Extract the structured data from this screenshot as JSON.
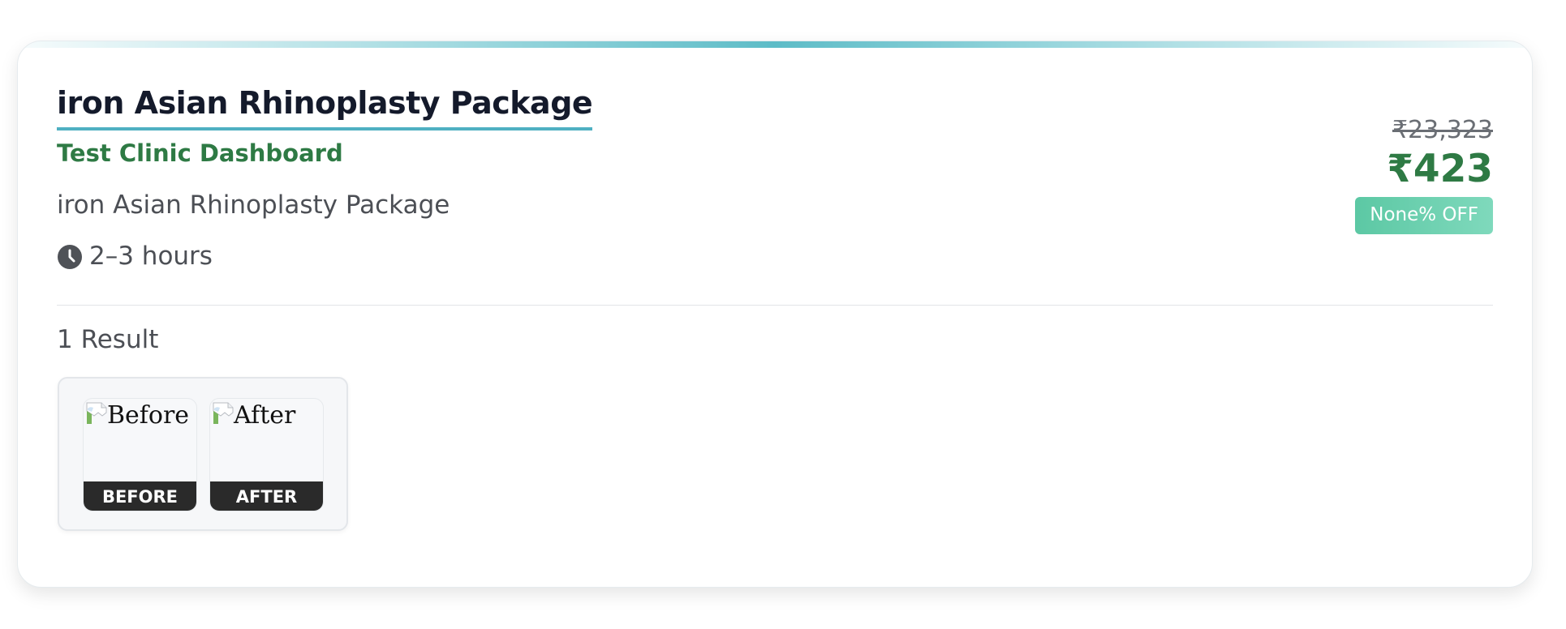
{
  "package": {
    "title": "iron Asian Rhinoplasty Package",
    "clinic": "Test Clinic Dashboard",
    "description": "iron Asian Rhinoplasty Package",
    "duration": "2–3 hours",
    "icons": {
      "duration": "clock-icon"
    }
  },
  "pricing": {
    "original_price": "₹23,323",
    "price": "₹423",
    "discount_badge": "None% OFF"
  },
  "results": {
    "count_label": "1 Result",
    "items": [
      {
        "before_alt": "Before",
        "before_label": "BEFORE",
        "after_alt": "After",
        "after_label": "AFTER"
      }
    ]
  },
  "colors": {
    "title": "#141a2b",
    "clinic": "#2e7a44",
    "price": "#2e7a44",
    "accent": "#4fb0c2",
    "discount_badge": "#5cc8a4",
    "image_label_bg": "#2a2a2a"
  }
}
